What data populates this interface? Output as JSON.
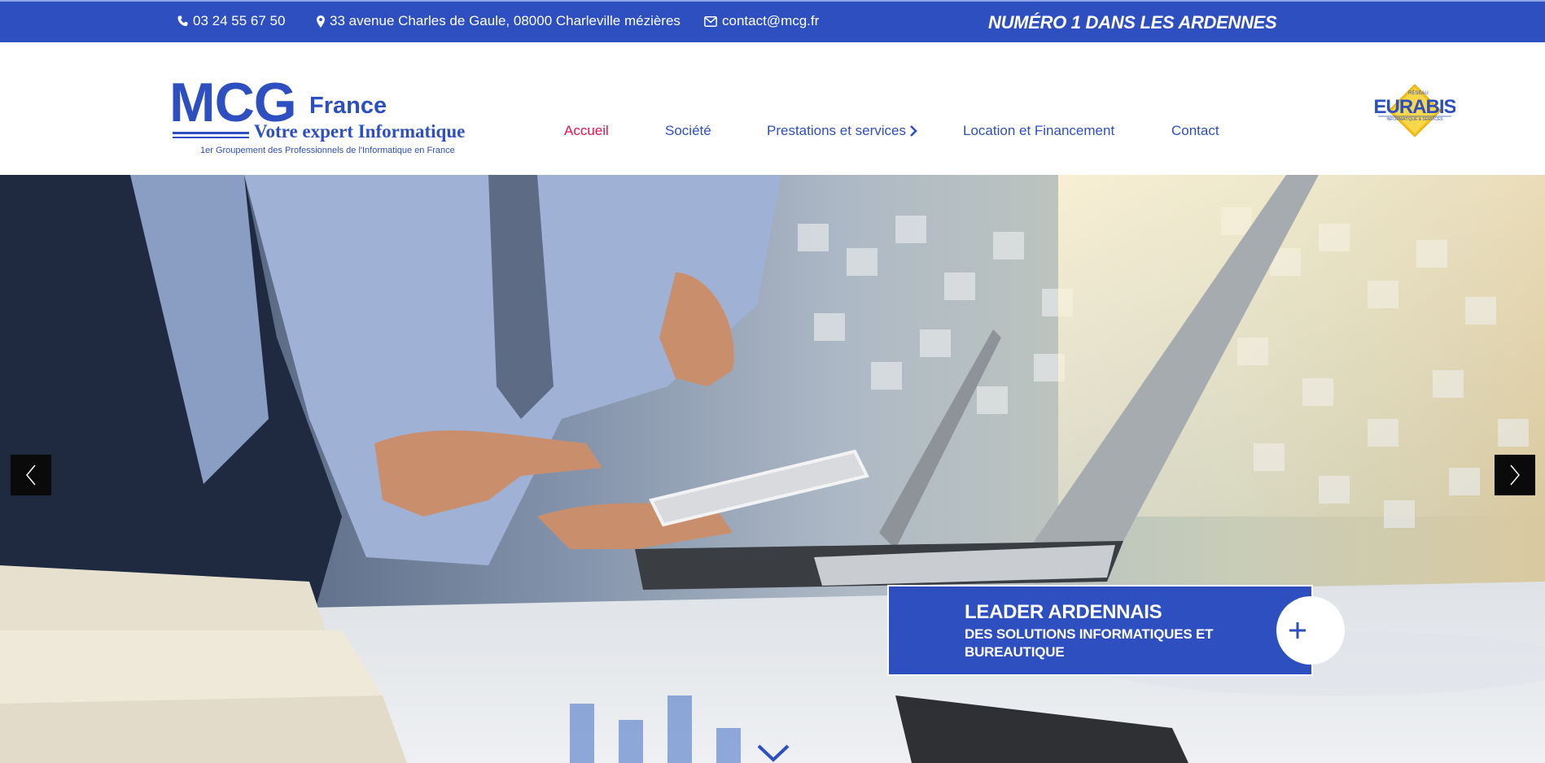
{
  "topbar": {
    "phone": "03 24 55 67 50",
    "address": "33 avenue Charles de Gaule, 08000 Charleville mézières",
    "email": "contact@mcg.fr",
    "slogan": "NUMÉRO 1 DANS LES ARDENNES"
  },
  "logo": {
    "brand": "MCG",
    "country": "France",
    "tagline": "Votre expert Informatique",
    "subline": "1er Groupement des Professionnels de l'Informatique en France"
  },
  "nav": {
    "items": [
      {
        "label": "Accueil"
      },
      {
        "label": "Société"
      },
      {
        "label": "Prestations et services"
      },
      {
        "label": "Location et Financement"
      },
      {
        "label": "Contact"
      }
    ]
  },
  "partner_logo": {
    "name": "EURABIS",
    "top": "RÉSEAU",
    "sub": "INFORMATIQUE & SERVICES"
  },
  "hero": {
    "caption_title": "LEADER ARDENNAIS",
    "caption_sub": "DES SOLUTIONS INFORMATIQUES ET BUREAUTIQUE"
  },
  "colors": {
    "brand_blue": "#2e4fbf",
    "active_red": "#e5134a"
  }
}
